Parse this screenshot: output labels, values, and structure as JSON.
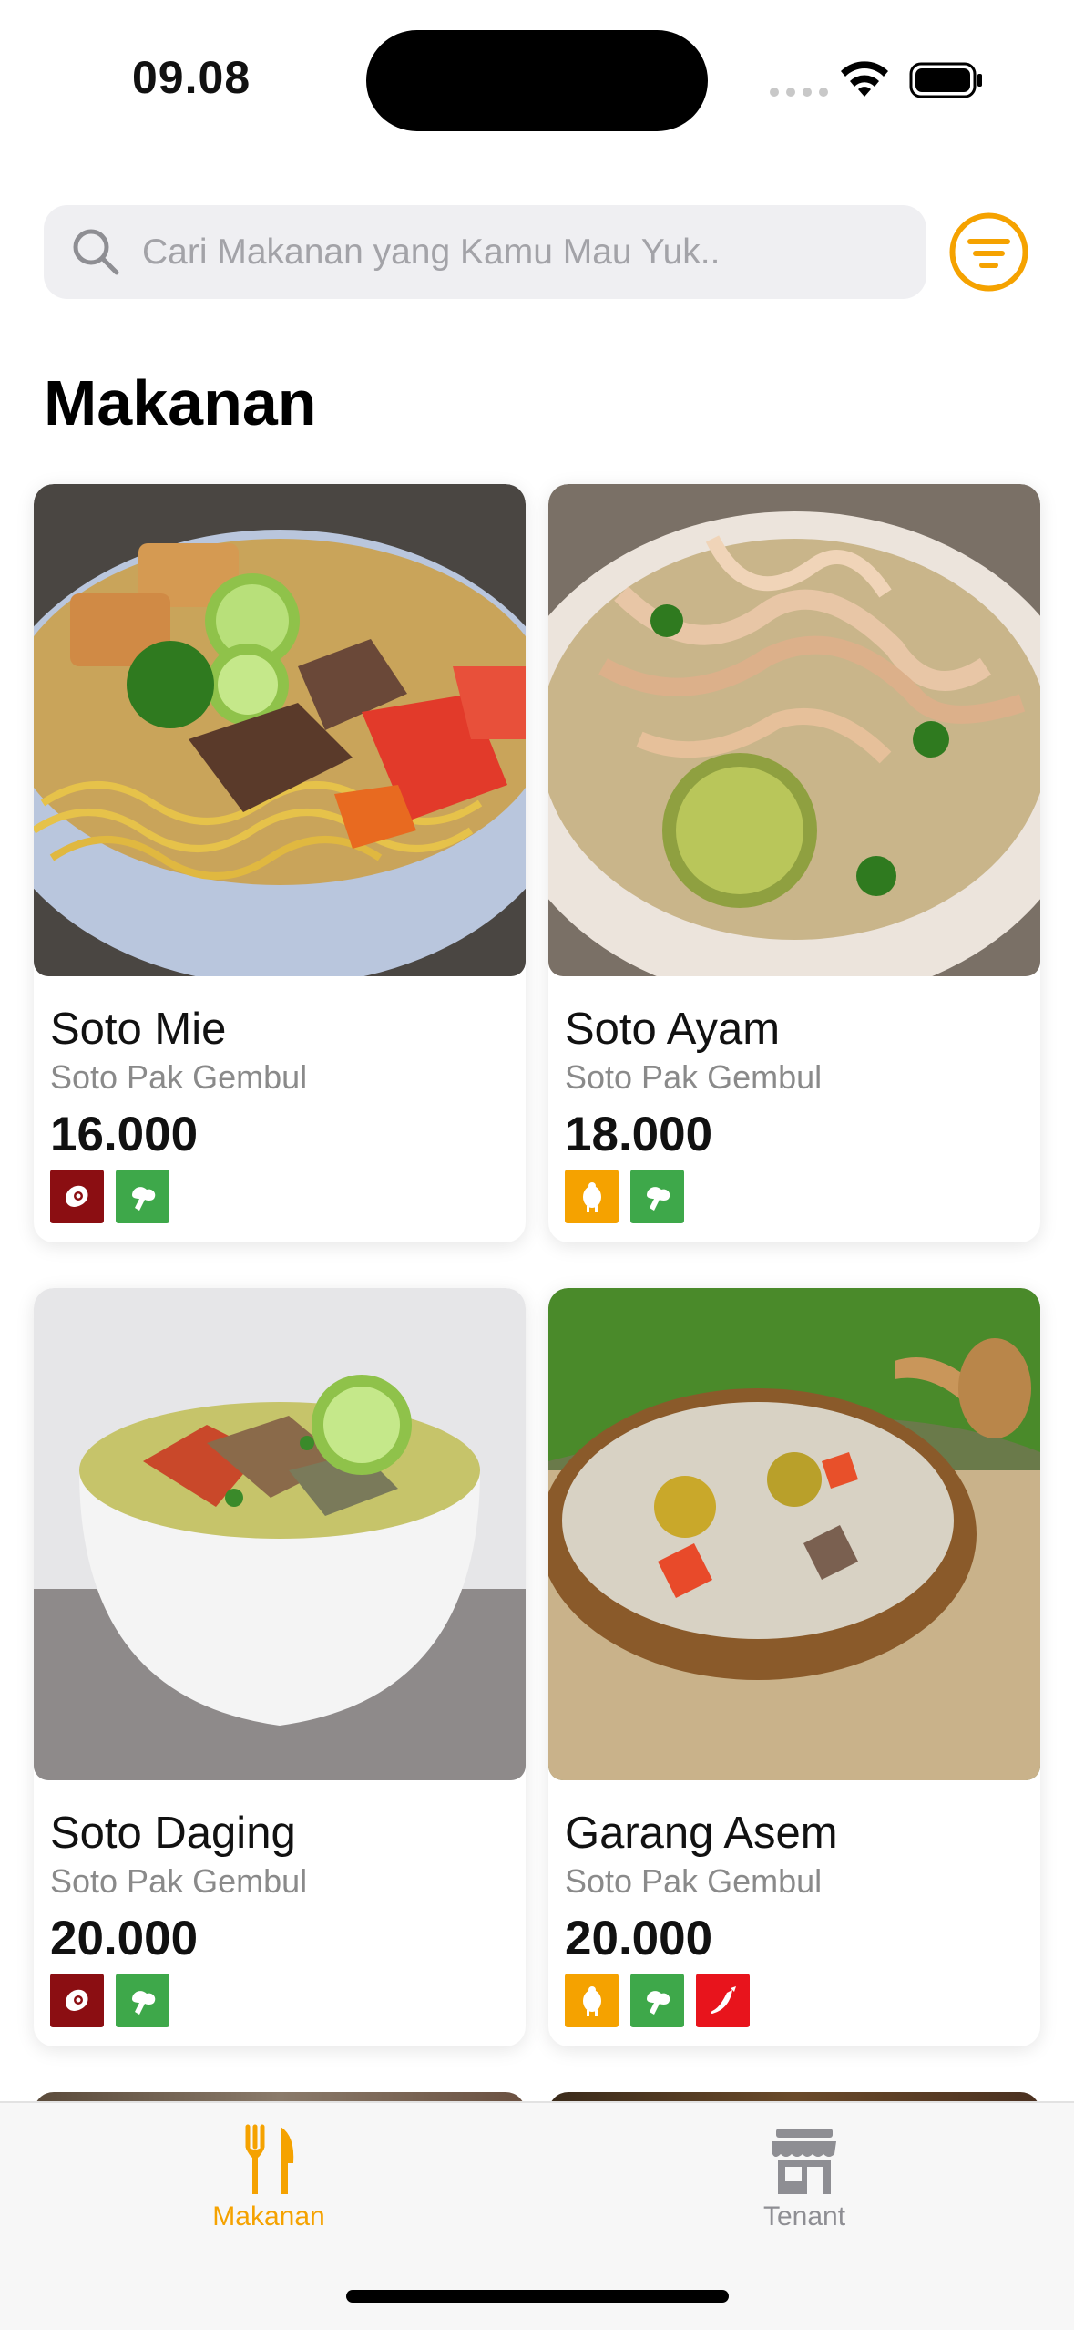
{
  "status_bar": {
    "time": "09.08"
  },
  "search": {
    "placeholder": "Cari Makanan yang Kamu Mau Yuk.."
  },
  "section": {
    "title": "Makanan"
  },
  "foods": [
    {
      "name": "Soto Mie",
      "tenant": "Soto Pak Gembul",
      "price": "16.000",
      "tags": [
        "beef-icon",
        "vegetable-icon"
      ]
    },
    {
      "name": "Soto Ayam",
      "tenant": "Soto Pak Gembul",
      "price": "18.000",
      "tags": [
        "chicken-icon",
        "vegetable-icon"
      ]
    },
    {
      "name": "Soto Daging",
      "tenant": "Soto Pak Gembul",
      "price": "20.000",
      "tags": [
        "beef-icon",
        "vegetable-icon"
      ]
    },
    {
      "name": "Garang Asem",
      "tenant": "Soto Pak Gembul",
      "price": "20.000",
      "tags": [
        "chicken-icon",
        "vegetable-icon",
        "chili-icon"
      ]
    }
  ],
  "tabbar": {
    "items": [
      {
        "label": "Makanan",
        "icon": "fork-knife-icon",
        "active": true
      },
      {
        "label": "Tenant",
        "icon": "store-icon",
        "active": false
      }
    ]
  },
  "colors": {
    "accent": "#f5a200",
    "beef_tag": "#8b0e12",
    "vegetable_tag": "#3ea84a",
    "chicken_tag": "#f5a200",
    "chili_tag": "#e8141c",
    "inactive_tab": "#8e8e93"
  }
}
